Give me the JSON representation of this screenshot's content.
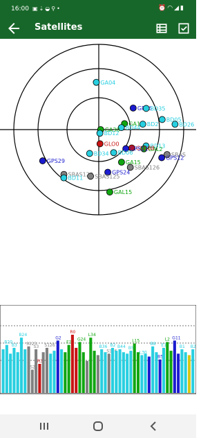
{
  "status_bar": {
    "time": "16:00",
    "left_icons": [
      "image-icon",
      "download-icon",
      "android-icon",
      "search-icon",
      "dot-icon"
    ],
    "right_icons": [
      "alarm-icon",
      "wifi-icon",
      "signal-icon",
      "battery-icon"
    ]
  },
  "app_bar": {
    "title": "Satellites",
    "back_icon": "arrow-back-icon",
    "actions": [
      "list-view-icon",
      "checkbox-icon"
    ]
  },
  "colors": {
    "app_bar": "#18672a",
    "gps": "#1b1bcf",
    "galileo": "#11a611",
    "glonass": "#c81414",
    "beidou": "#28cfe0",
    "sbas": "#808080",
    "qzss": "#d8c618"
  },
  "sky_plot": {
    "satellites": [
      {
        "label": "GA04",
        "color": "#28cfe0",
        "az": 357,
        "el": 40
      },
      {
        "label": "GP36",
        "color": "#1b1bcf",
        "az": 58,
        "el": 47
      },
      {
        "label": "BD35",
        "color": "#28cfe0",
        "az": 66,
        "el": 35
      },
      {
        "label": "GA11",
        "color": "#11a611",
        "az": 77,
        "el": 62
      },
      {
        "label": "BD44",
        "color": "#28cfe0",
        "az": 85,
        "el": 66
      },
      {
        "label": "BD2",
        "color": "#28cfe0",
        "az": 83,
        "el": 43
      },
      {
        "label": "BD05",
        "color": "#28cfe0",
        "az": 81,
        "el": 22
      },
      {
        "label": "BD26",
        "color": "#28cfe0",
        "az": 86,
        "el": 9
      },
      {
        "label": "GA30",
        "color": "#11a611",
        "az": 90,
        "el": 88
      },
      {
        "label": "BD12",
        "color": "#28cfe0",
        "az": 163,
        "el": 86
      },
      {
        "label": "BD13",
        "color": "#28cfe0",
        "az": 109,
        "el": 37
      },
      {
        "label": "GAL2",
        "color": "#11a611",
        "az": 113,
        "el": 38
      },
      {
        "label": "GLO08",
        "color": "#c81414",
        "az": 119,
        "el": 50
      },
      {
        "label": "GPS11",
        "color": "#1b1bcf",
        "az": 125,
        "el": 55
      },
      {
        "label": "BD06",
        "color": "#28cfe0",
        "az": 147,
        "el": 61
      },
      {
        "label": "GLO0",
        "color": "#c81414",
        "az": 175,
        "el": 75
      },
      {
        "label": "SBAS",
        "color": "#808080",
        "az": 110,
        "el": 13
      },
      {
        "label": "GPS12",
        "color": "#1b1bcf",
        "az": 114,
        "el": 17
      },
      {
        "label": "SBAS126",
        "color": "#808080",
        "az": 140,
        "el": 38
      },
      {
        "label": "GA15",
        "color": "#11a611",
        "az": 145,
        "el": 48
      },
      {
        "label": "GPS24",
        "color": "#1b1bcf",
        "az": 168,
        "el": 44
      },
      {
        "label": "BD34",
        "color": "#28cfe0",
        "az": 201,
        "el": 63
      },
      {
        "label": "SBAS120",
        "color": "#808080",
        "az": 218,
        "el": 30
      },
      {
        "label": "BD11",
        "color": "#28cfe0",
        "az": 216,
        "el": 27
      },
      {
        "label": "SBAS125",
        "color": "#808080",
        "az": 190,
        "el": 40
      },
      {
        "label": "GAL15",
        "color": "#11a611",
        "az": 170,
        "el": 23
      },
      {
        "label": "GPS29",
        "color": "#1b1bcf",
        "az": 241,
        "el": 22
      }
    ]
  },
  "signal_chart": {
    "bars": [
      {
        "color": "#28cfe0",
        "label": "",
        "value": 30
      },
      {
        "color": "#28cfe0",
        "label": "B20",
        "value": 33
      },
      {
        "color": "#28cfe0",
        "label": "",
        "value": 27
      },
      {
        "color": "#28cfe0",
        "label": "B3",
        "value": 31
      },
      {
        "color": "#28cfe0",
        "label": "",
        "value": 28
      },
      {
        "color": "#28cfe0",
        "label": "B24",
        "value": 38
      },
      {
        "color": "#28cfe0",
        "label": "",
        "value": 30
      },
      {
        "color": "#808080",
        "label": "S123",
        "value": 32
      },
      {
        "color": "#808080",
        "label": "S2",
        "value": 16
      },
      {
        "color": "#808080",
        "label": "S3",
        "value": 30
      },
      {
        "color": "#c81414",
        "label": "R3",
        "value": 20
      },
      {
        "color": "#808080",
        "label": "",
        "value": 28
      },
      {
        "color": "#808080",
        "label": "S126",
        "value": 31
      },
      {
        "color": "#28cfe0",
        "label": "",
        "value": 27
      },
      {
        "color": "#28cfe0",
        "label": "",
        "value": 29
      },
      {
        "color": "#1b1bcf",
        "label": "G2",
        "value": 36
      },
      {
        "color": "#28cfe0",
        "label": "",
        "value": 30
      },
      {
        "color": "#11a611",
        "label": "",
        "value": 28
      },
      {
        "color": "#11a611",
        "label": "E14",
        "value": 33
      },
      {
        "color": "#c81414",
        "label": "R0",
        "value": 40
      },
      {
        "color": "#c81414",
        "label": "",
        "value": 31
      },
      {
        "color": "#11a611",
        "label": "G24",
        "value": 35
      },
      {
        "color": "#11a611",
        "label": "",
        "value": 28
      },
      {
        "color": "#808080",
        "label": "",
        "value": 22
      },
      {
        "color": "#11a611",
        "label": "L34",
        "value": 38
      },
      {
        "color": "#11a611",
        "label": "",
        "value": 29
      },
      {
        "color": "#808080",
        "label": "",
        "value": 26
      },
      {
        "color": "#28cfe0",
        "label": "B36",
        "value": 30
      },
      {
        "color": "#28cfe0",
        "label": "",
        "value": 28
      },
      {
        "color": "#808080",
        "label": "S126",
        "value": 27
      },
      {
        "color": "#28cfe0",
        "label": "B2",
        "value": 31
      },
      {
        "color": "#28cfe0",
        "label": "",
        "value": 29
      },
      {
        "color": "#28cfe0",
        "label": "B44",
        "value": 30
      },
      {
        "color": "#28cfe0",
        "label": "",
        "value": 28
      },
      {
        "color": "#28cfe0",
        "label": "",
        "value": 27
      },
      {
        "color": "#28cfe0",
        "label": "B5",
        "value": 29
      },
      {
        "color": "#11a611",
        "label": "L15",
        "value": 34
      },
      {
        "color": "#11a611",
        "label": "",
        "value": 28
      },
      {
        "color": "#28cfe0",
        "label": "L30",
        "value": 26
      },
      {
        "color": "#28cfe0",
        "label": "",
        "value": 27
      },
      {
        "color": "#1b1bcf",
        "label": "",
        "value": 25
      },
      {
        "color": "#28cfe0",
        "label": "B8",
        "value": 32
      },
      {
        "color": "#28cfe0",
        "label": "",
        "value": 28
      },
      {
        "color": "#1b1bcf",
        "label": "B5",
        "value": 23
      },
      {
        "color": "#28cfe0",
        "label": "E1",
        "value": 31
      },
      {
        "color": "#11a611",
        "label": "L2",
        "value": 35
      },
      {
        "color": "#11a611",
        "label": "",
        "value": 29
      },
      {
        "color": "#1b1bcf",
        "label": "G11",
        "value": 36
      },
      {
        "color": "#1b1bcf",
        "label": "",
        "value": 27
      },
      {
        "color": "#28cfe0",
        "label": "B1",
        "value": 30
      },
      {
        "color": "#28cfe0",
        "label": "",
        "value": 28
      },
      {
        "color": "#d8c618",
        "label": "",
        "value": 26
      },
      {
        "color": "#28cfe0",
        "label": "B2",
        "value": 30
      }
    ]
  },
  "nav_bar": {
    "buttons": [
      "recent-apps-icon",
      "home-icon",
      "back-icon"
    ]
  }
}
